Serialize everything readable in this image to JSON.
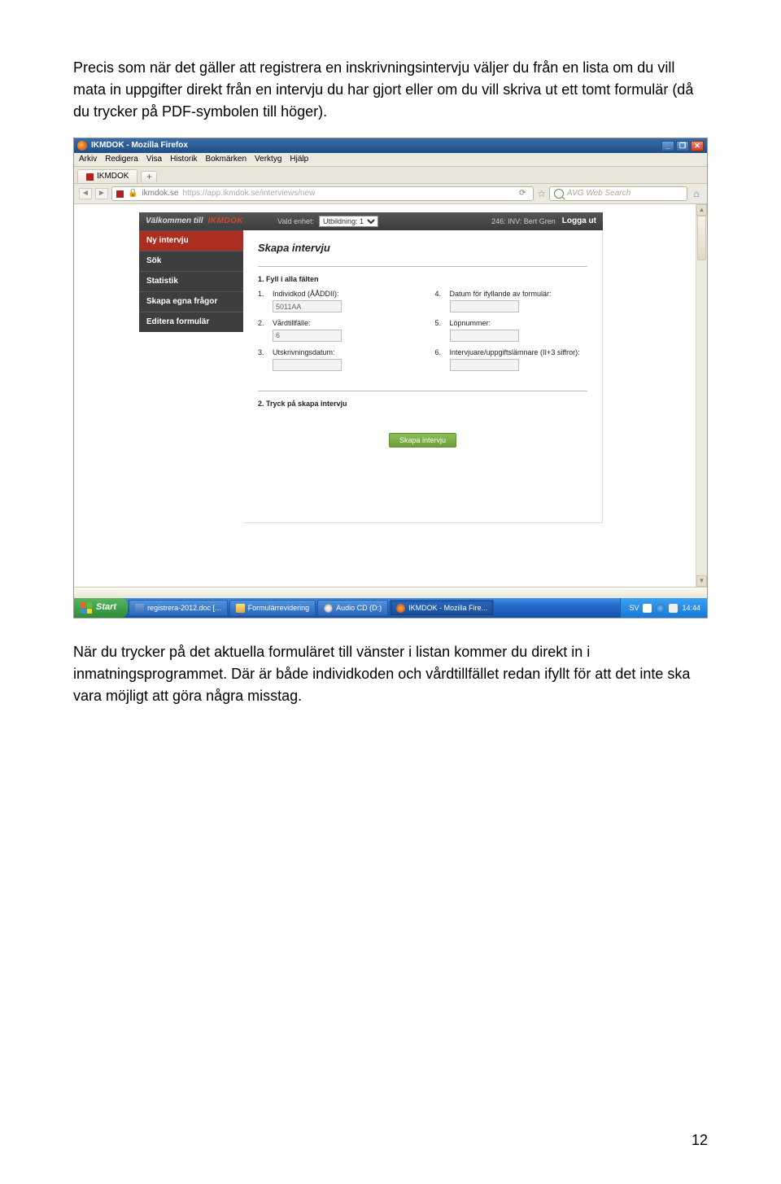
{
  "intro_para": "Precis som när det gäller att registrera en inskrivningsintervju väljer du från en lista om du vill mata in uppgifter direkt från en intervju du har gjort eller om du vill skriva ut ett tomt formulär (då du trycker på PDF-symbolen till höger).",
  "browser": {
    "title": "IKMDOK - Mozilla Firefox",
    "menus": [
      "Arkiv",
      "Redigera",
      "Visa",
      "Historik",
      "Bokmärken",
      "Verktyg",
      "Hjälp"
    ],
    "tab": "IKMDOK",
    "url_host": "ikmdok.se",
    "url_full": "https://app.ikmdok.se/interviews/new",
    "search_placeholder": "AVG Web Search"
  },
  "app": {
    "brand_pre": "Välkommen till",
    "brand_name": "IKMDOK",
    "vald_enhet_label": "Vald enhet:",
    "vald_enhet_value": "Utbildning: 1",
    "user_info": "246: INV: Bert Gren",
    "logout": "Logga ut",
    "sidebar": {
      "items": [
        {
          "label": "Ny intervju"
        },
        {
          "label": "Sök"
        },
        {
          "label": "Statistik"
        },
        {
          "label": "Skapa egna frågor"
        },
        {
          "label": "Editera formulär"
        }
      ]
    },
    "panel": {
      "heading": "Skapa intervju",
      "step1": "1. Fyll i alla fälten",
      "step2": "2. Tryck på skapa intervju",
      "fields": {
        "f1": {
          "num": "1.",
          "label": "Individkod (ÅÅDDII):",
          "value": "5011AA"
        },
        "f2": {
          "num": "2.",
          "label": "Vårdtillfälle:",
          "value": "6"
        },
        "f3": {
          "num": "3.",
          "label": "Utskrivningsdatum:",
          "value": ""
        },
        "f4": {
          "num": "4.",
          "label": "Datum för ifyllande av formulär:",
          "value": ""
        },
        "f5": {
          "num": "5.",
          "label": "Löpnummer:",
          "value": ""
        },
        "f6": {
          "num": "6.",
          "label": "Intervjuare/uppgiftslämnare (II+3 siffror):",
          "value": ""
        }
      },
      "button": "Skapa intervju"
    }
  },
  "taskbar": {
    "start": "Start",
    "items": [
      "registrera-2012.doc [...",
      "Formulärrevidering",
      "Audio CD (D:)",
      "IKMDOK - Mozilla Fire..."
    ],
    "lang": "SV",
    "clock": "14:44"
  },
  "outro_para": "När du trycker på det aktuella formuläret till vänster i listan kommer du direkt in i inmatningsprogrammet. Där är både individkoden och vårdtillfället redan ifyllt för att det inte ska vara möjligt att göra några misstag.",
  "page_number": "12"
}
